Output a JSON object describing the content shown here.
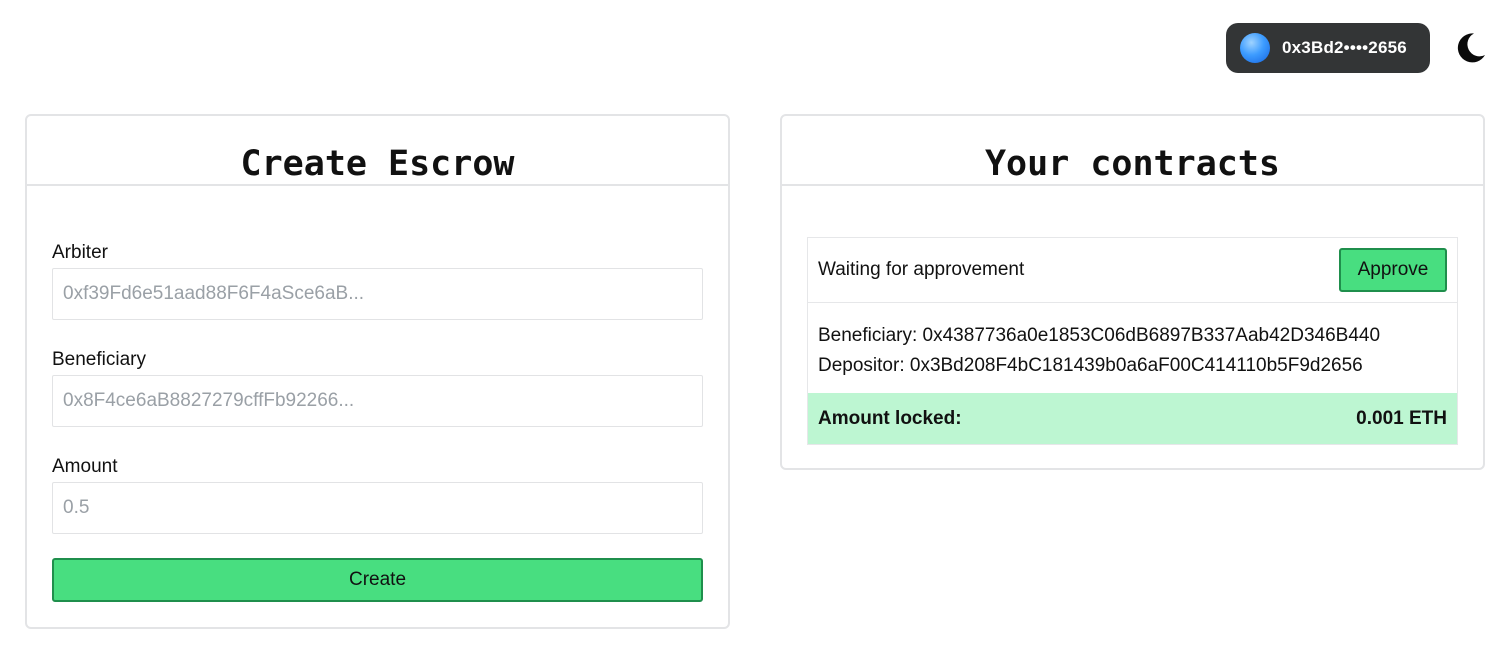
{
  "header": {
    "wallet_address": "0x3Bd2••••2656",
    "avatar_icon": "wallet-avatar-icon",
    "theme_icon": "moon-icon"
  },
  "create_escrow": {
    "title": "Create Escrow",
    "arbiter": {
      "label": "Arbiter",
      "placeholder": "0xf39Fd6e51aad88F6F4aSce6aB...",
      "value": ""
    },
    "beneficiary": {
      "label": "Beneficiary",
      "placeholder": "0x8F4ce6aB8827279cffFb92266...",
      "value": ""
    },
    "amount": {
      "label": "Amount",
      "placeholder": "0.5",
      "value": ""
    },
    "create_label": "Create"
  },
  "contracts": {
    "title": "Your contracts",
    "items": [
      {
        "status": "Waiting for approvement",
        "approve_label": "Approve",
        "beneficiary_line": "Beneficiary: 0x4387736a0e1853C06dB6897B337Aab42D346B440",
        "depositor_line": "Depositor: 0x3Bd208F4bC181439b0a6aF00C414110b5F9d2656",
        "amount_label": "Amount locked:",
        "amount_value": "0.001 ETH"
      }
    ]
  },
  "colors": {
    "accent_green": "#48de80",
    "accent_green_border": "#1f8f4c",
    "amount_bg": "#bdf6d2",
    "wallet_pill_bg": "#333536"
  }
}
